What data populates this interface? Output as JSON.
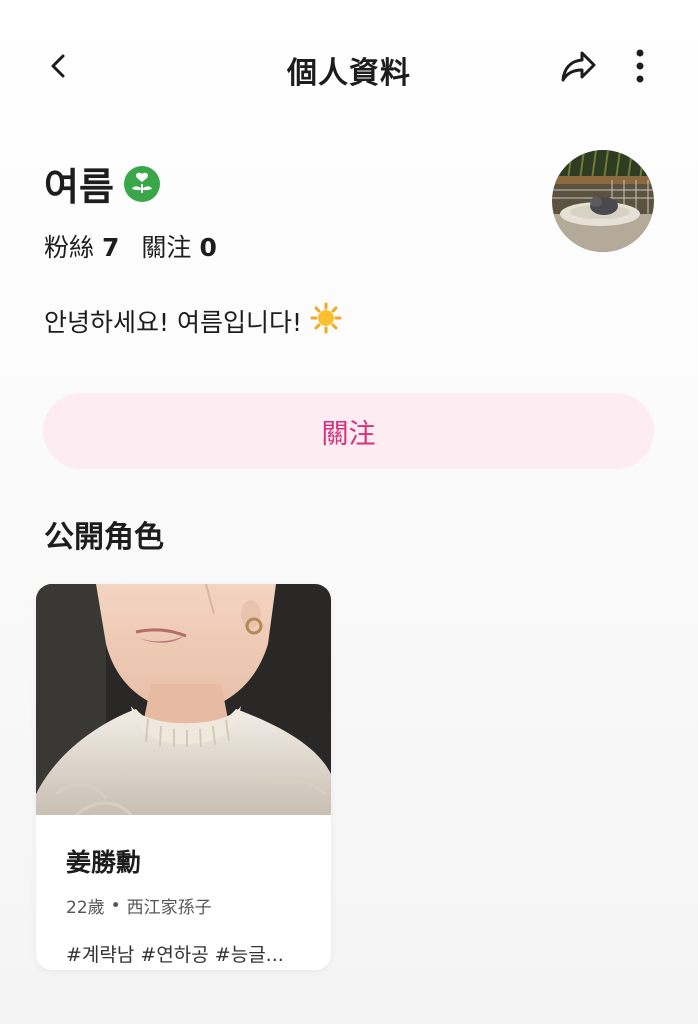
{
  "header": {
    "title": "個人資料",
    "back_icon": "back-arrow-icon",
    "share_icon": "share-icon",
    "more_icon": "more-vertical-icon"
  },
  "profile": {
    "name": "여름",
    "badge_icon": "sprout-heart-badge-icon",
    "followers_label": "粉絲",
    "followers_count": "7",
    "following_label": "關注",
    "following_count": "0",
    "bio": "안녕하세요! 여름입니다!",
    "bio_emoji": "☀️"
  },
  "follow_button": {
    "label": "關注"
  },
  "section": {
    "title": "公開角色"
  },
  "characters": [
    {
      "name": "姜勝勳",
      "age": "22歲",
      "separator": "•",
      "description": "西江家孫子",
      "tags": "#계략남 #연하공 #능글..."
    }
  ],
  "colors": {
    "accent": "#d6317a",
    "follow_bg": "#fdedf3",
    "badge": "#3aa64a"
  }
}
